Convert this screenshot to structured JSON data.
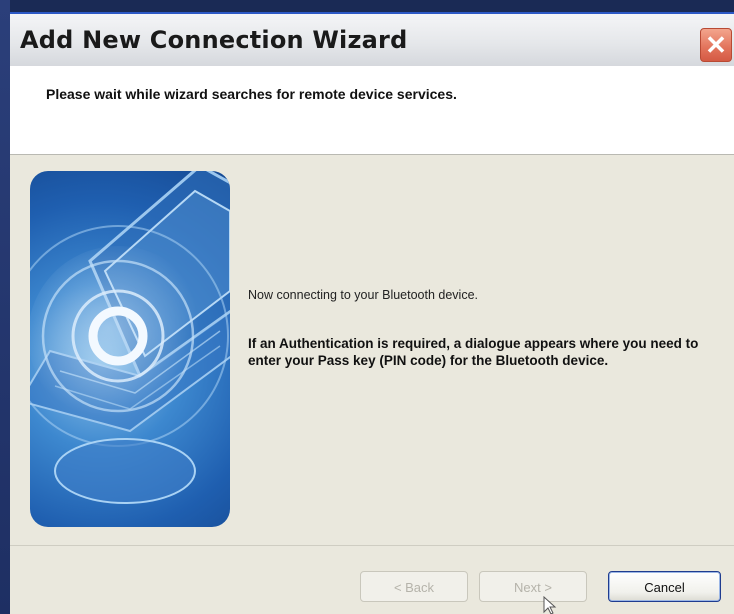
{
  "window": {
    "title": "Add New Connection Wizard",
    "close_glyph": "✕"
  },
  "header": {
    "instruction": "Please wait while wizard searches for remote device services."
  },
  "content": {
    "status_message": "Now connecting to your Bluetooth device.",
    "auth_message": "If an Authentication is required, a dialogue appears where you need to enter your Pass key (PIN code) for the Bluetooth device.",
    "illustration_icon": "bluetooth-laptop-illustration"
  },
  "buttons": {
    "back_label": "< Back",
    "next_label": "Next >",
    "cancel_label": "Cancel"
  },
  "colors": {
    "title_border": "#2c59c6",
    "close_button": "#e2725a",
    "panel_background": "#eae8dd",
    "header_background": "#ffffff",
    "cancel_border": "#1f3c8f"
  }
}
